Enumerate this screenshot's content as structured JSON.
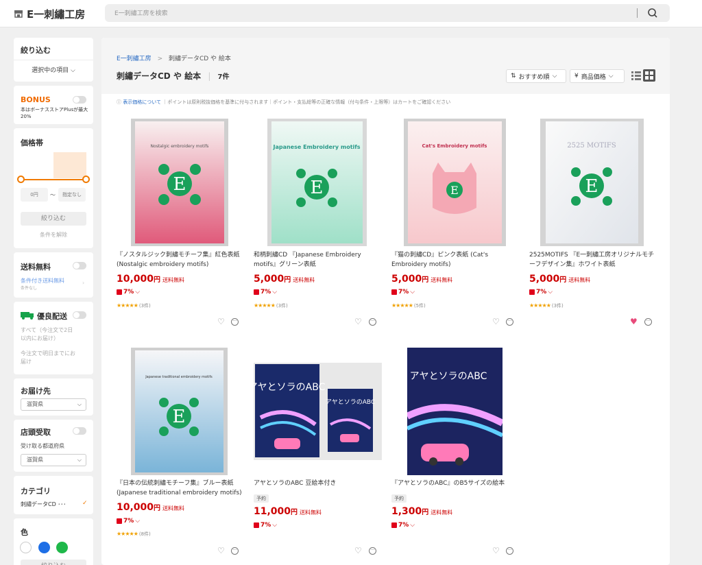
{
  "header": {
    "logo": "E一刺繡工房",
    "search_placeholder": "E一刺繡工房を検索"
  },
  "sidebar": {
    "filter_title": "絞り込む",
    "selected_items": "選択中の項目",
    "bonus_title": "BONUS",
    "bonus_desc": "本はボーナスストアPlusが最大20%",
    "price_title": "価格帯",
    "price_min": "0円",
    "price_sep": "～",
    "price_max": "指定なし",
    "narrow_button": "絞り込む",
    "clear_conditions": "条件を解除",
    "free_shipping_title": "送料無料",
    "conditional_free_shipping": "条件付き送料無料",
    "conditional_none": "条件なし",
    "priority_delivery_title": "優良配送",
    "delivery_all": "すべて（今注文で2日以内にお届け）",
    "delivery_tomorrow": "今注文で明日までにお届け",
    "deliver_to_title": "お届け先",
    "deliver_to_value": "滋賀県",
    "store_pickup_title": "店頭受取",
    "pickup_pref_label": "受け取る都道府県",
    "pickup_pref_value": "滋賀県",
    "category_title": "カテゴリ",
    "category_value": "刺繡データCD ･･･",
    "color_title": "色",
    "color_button": "絞り込む",
    "colors": [
      "#ffffff",
      "#1e6fe6",
      "#1fb84a"
    ]
  },
  "main": {
    "breadcrumb_root": "E一刺繡工房",
    "breadcrumb_sep": ">",
    "breadcrumb_current": "刺繡データCD や 絵本",
    "title": "刺繡データCD や 絵本",
    "count": "7件",
    "sort_label": "おすすめ順",
    "price_sort_label": "商品価格",
    "notice_link": "表示価格について",
    "notice_text": "｜ポイントは原則税抜価格を基準に付与されます｜ポイント・支払総等の正確な情報（付与条件・上限等）はカートをご確認ください"
  },
  "products": [
    {
      "title": "『ノスタルジック刺繡モチーフ集』紅色表紙 (Nostalgic embroidery motifs)",
      "price": "10,000",
      "yen": "円",
      "ship": "送料無料",
      "points": "7%",
      "rating_count": "(3件)",
      "favorited": false,
      "badge": "",
      "cover_title": "Nostalgic embroidery motifs"
    },
    {
      "title": "和柄刺繡CD 『Japanese Embroidery motifs』グリーン表紙",
      "price": "5,000",
      "yen": "円",
      "ship": "送料無料",
      "points": "7%",
      "rating_count": "(3件)",
      "favorited": false,
      "badge": "",
      "cover_title": "Japanese Embroidery motifs"
    },
    {
      "title": "『猫の刺繡CD』ピンク表紙 (Cat's Embroidery motifs)",
      "price": "5,000",
      "yen": "円",
      "ship": "送料無料",
      "points": "7%",
      "rating_count": "(5件)",
      "favorited": false,
      "badge": "",
      "cover_title": "Cat's Embroidery motifs"
    },
    {
      "title": "2525MOTIFS 『E一刺繡工房オリジナルモチーフデザイン集』ホワイト表紙",
      "price": "5,000",
      "yen": "円",
      "ship": "送料無料",
      "points": "7%",
      "rating_count": "(3件)",
      "favorited": true,
      "badge": "",
      "cover_title": "2525 MOTIFS"
    },
    {
      "title": "『日本の伝統刺繡モチーフ集』ブルー表紙 (Japanese traditional embroidery motifs)",
      "price": "10,000",
      "yen": "円",
      "ship": "送料無料",
      "points": "7%",
      "rating_count": "(8件)",
      "favorited": false,
      "badge": "",
      "cover_title": "Japanese traditional embroidery motifs"
    },
    {
      "title": "アヤとソラのABC 豆絵本付き",
      "price": "11,000",
      "yen": "円",
      "ship": "送料無料",
      "points": "7%",
      "rating_count": "",
      "favorited": false,
      "badge": "予約",
      "cover_title": "アヤとソラのABC"
    },
    {
      "title": "『アヤとソラのABC』のB5サイズの絵本",
      "price": "1,300",
      "yen": "円",
      "ship": "送料無料",
      "points": "7%",
      "rating_count": "",
      "favorited": false,
      "badge": "予約",
      "cover_title": "アヤとソラのABC"
    }
  ],
  "icons": {
    "search": "search-icon",
    "heart": "heart-icon",
    "more": "more-icon",
    "truck": "truck-icon",
    "list_view": "list-view-icon",
    "grid_view": "grid-view-icon"
  }
}
